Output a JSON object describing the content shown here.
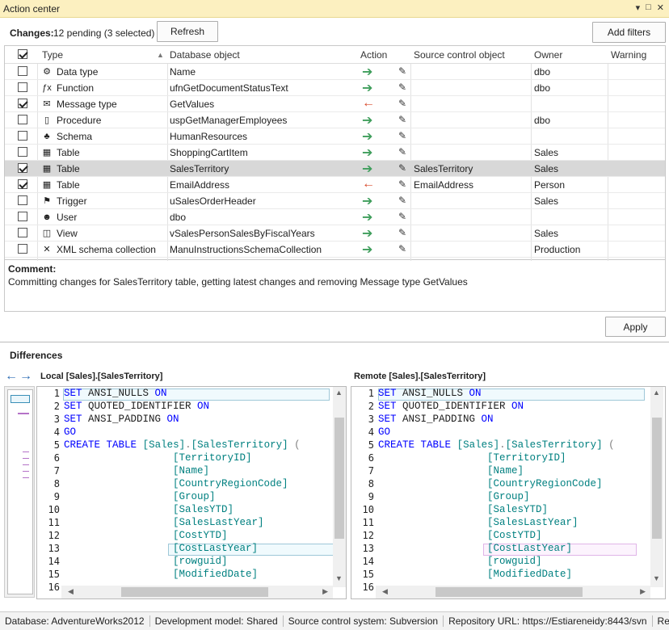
{
  "window": {
    "title": "Action center"
  },
  "toolbar": {
    "changes_label": "Changes:",
    "changes_value": "12 pending (3 selected)",
    "refresh": "Refresh",
    "add_filters": "Add filters"
  },
  "columns": {
    "type": "Type",
    "database_object": "Database object",
    "action": "Action",
    "source_control_object": "Source control object",
    "owner": "Owner",
    "warning": "Warning"
  },
  "rows": [
    {
      "checked": false,
      "type": "Data type",
      "icon": "data-type-icon",
      "object": "Name",
      "action": "green",
      "source": "",
      "owner": "dbo"
    },
    {
      "checked": false,
      "type": "Function",
      "icon": "function-icon",
      "object": "ufnGetDocumentStatusText",
      "action": "green",
      "source": "",
      "owner": "dbo"
    },
    {
      "checked": true,
      "type": "Message type",
      "icon": "message-type-icon",
      "object": "GetValues",
      "action": "red",
      "source": "",
      "owner": ""
    },
    {
      "checked": false,
      "type": "Procedure",
      "icon": "procedure-icon",
      "object": "uspGetManagerEmployees",
      "action": "green",
      "source": "",
      "owner": "dbo"
    },
    {
      "checked": false,
      "type": "Schema",
      "icon": "schema-icon",
      "object": "HumanResources",
      "action": "green",
      "source": "",
      "owner": ""
    },
    {
      "checked": false,
      "type": "Table",
      "icon": "table-icon",
      "object": "ShoppingCartItem",
      "action": "green",
      "source": "",
      "owner": "Sales"
    },
    {
      "checked": true,
      "type": "Table",
      "icon": "table-icon",
      "object": "SalesTerritory",
      "action": "green",
      "source": "SalesTerritory",
      "owner": "Sales",
      "selected": true
    },
    {
      "checked": true,
      "type": "Table",
      "icon": "table-icon",
      "object": "EmailAddress",
      "action": "red",
      "source": "EmailAddress",
      "owner": "Person"
    },
    {
      "checked": false,
      "type": "Trigger",
      "icon": "trigger-icon",
      "object": "uSalesOrderHeader",
      "action": "green",
      "source": "",
      "owner": "Sales"
    },
    {
      "checked": false,
      "type": "User",
      "icon": "user-icon",
      "object": "dbo",
      "action": "green",
      "source": "",
      "owner": ""
    },
    {
      "checked": false,
      "type": "View",
      "icon": "view-icon",
      "object": "vSalesPersonSalesByFiscalYears",
      "action": "green",
      "source": "",
      "owner": "Sales"
    },
    {
      "checked": false,
      "type": "XML schema collection",
      "icon": "xml-schema-icon",
      "object": "ManuInstructionsSchemaCollection",
      "action": "green",
      "source": "",
      "owner": "Production"
    }
  ],
  "comment": {
    "label": "Comment:",
    "text": "Committing changes for SalesTerritory table, getting latest changes and removing Message type GetValues"
  },
  "apply": "Apply",
  "differences": {
    "title": "Differences",
    "local_label": "Local [Sales].[SalesTerritory]",
    "remote_label": "Remote [Sales].[SalesTerritory]"
  },
  "code_lines": [
    [
      "kw",
      "SET",
      "",
      " ANSI_NULLS ",
      "kw",
      "ON"
    ],
    [
      "kw",
      "SET",
      "",
      " QUOTED_IDENTIFIER ",
      "kw",
      "ON"
    ],
    [
      "kw",
      "SET",
      "",
      " ANSI_PADDING ",
      "kw",
      "ON"
    ],
    [
      "kw",
      "GO"
    ],
    [
      "kw",
      "CREATE",
      "",
      " ",
      "kw",
      "TABLE",
      "",
      " ",
      "id",
      "[Sales]",
      "br",
      ".",
      "id",
      "[SalesTerritory]",
      "",
      " ",
      "br",
      "("
    ],
    [
      "",
      "                  ",
      "id",
      "[TerritoryID]"
    ],
    [
      "",
      "                  ",
      "id",
      "[Name]"
    ],
    [
      "",
      "                  ",
      "id",
      "[CountryRegionCode]"
    ],
    [
      "",
      "                  ",
      "id",
      "[Group]"
    ],
    [
      "",
      "                  ",
      "id",
      "[SalesYTD]"
    ],
    [
      "",
      "                  ",
      "id",
      "[SalesLastYear]"
    ],
    [
      "",
      "                  ",
      "id",
      "[CostYTD]"
    ],
    [
      "",
      "                  ",
      "id",
      "[CostLastYear]"
    ],
    [
      "",
      "                  ",
      "id",
      "[rowguid]"
    ],
    [
      "",
      "                  ",
      "id",
      "[ModifiedDate]"
    ],
    [
      ""
    ]
  ],
  "status": {
    "database": "Database: AdventureWorks2012",
    "dev_model": "Development model: Shared",
    "scs": "Source control system: Subversion",
    "repo": "Repository URL: https://Estiareneidy:8443/svn",
    "trunc": "Reposi"
  },
  "colors": {
    "accent": "#fcf0c0",
    "keyword": "#0000ff",
    "identifier": "#008080",
    "add": "#3f9e5c",
    "remove": "#d8492a"
  }
}
